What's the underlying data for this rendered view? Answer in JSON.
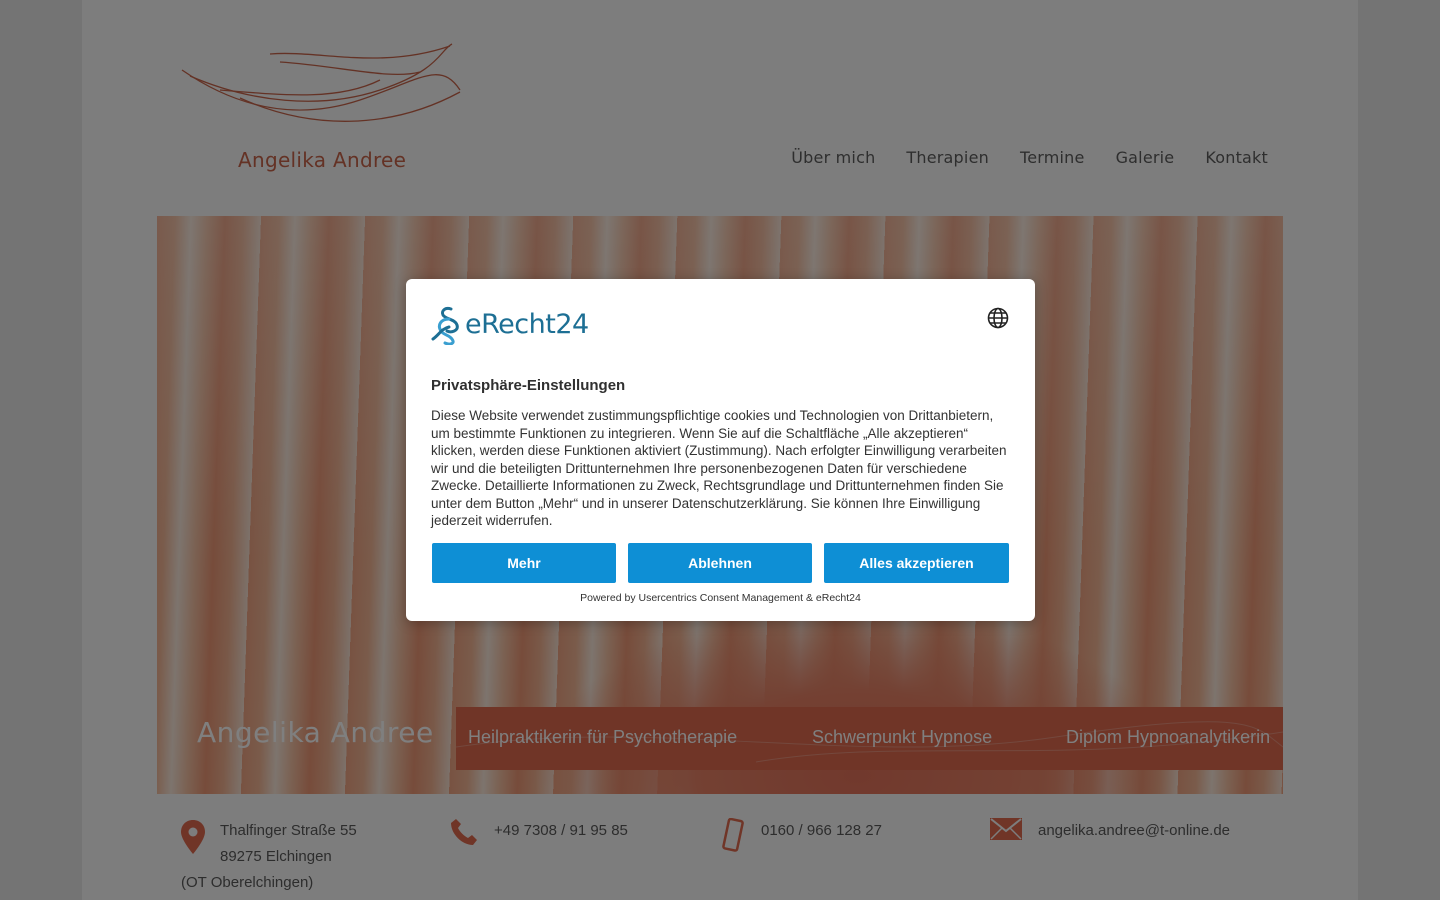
{
  "header": {
    "logo_text": "Angelika Andree",
    "nav": [
      "Über mich",
      "Therapien",
      "Termine",
      "Galerie",
      "Kontakt"
    ]
  },
  "hero": {
    "name": "Angelika Andree",
    "band": [
      "Heilpraktikerin für Psychotherapie",
      "Schwerpunkt Hypnose",
      "Diplom Hypnoanalytikerin"
    ]
  },
  "contact": {
    "address_line1": "Thalfinger Straße 55",
    "address_line2": "89275 Elchingen",
    "address_line3": "(OT Oberelchingen)",
    "phone": "+49 7308 / 91 95 85",
    "mobile": "0160 / 966 128 27",
    "email": "angelika.andree@t-online.de"
  },
  "consent": {
    "brand": "eRecht24",
    "title": "Privatsphäre-Einstellungen",
    "text": "Diese Website verwendet zustimmungspflichtige cookies und Technologien von Drittanbietern, um bestimmte Funktionen zu integrieren. Wenn Sie auf die Schaltfläche „Alle akzeptieren“ klicken, werden diese Funktionen aktiviert (Zustimmung). Nach erfolgter Einwilligung verarbeiten wir und die beteiligten Drittunternehmen Ihre personenbezogenen Daten für verschiedene Zwecke. Detaillierte Informationen zu Zweck, Rechtsgrundlage und Drittunternehmen finden Sie unter dem Button „Mehr“ und in unserer Datenschutzerklärung. Sie können Ihre Einwilligung jederzeit widerrufen.",
    "buttons": {
      "more": "Mehr",
      "decline": "Ablehnen",
      "accept_all": "Alles akzeptieren"
    },
    "powered_by": "Powered by Usercentrics Consent Management & eRecht24"
  },
  "colors": {
    "brand_orange": "#e06b4f",
    "consent_button": "#0e8fd5",
    "erecht_blue": "#1d6f94"
  }
}
